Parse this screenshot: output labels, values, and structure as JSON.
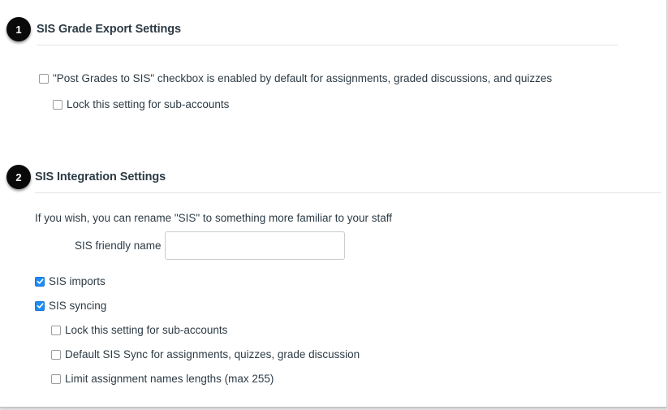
{
  "grade_export": {
    "step_number": "1",
    "title": "SIS Grade Export Settings",
    "options": [
      {
        "label": "\"Post Grades to SIS\" checkbox is enabled by default for assignments, graded discussions, and quizzes",
        "checked": false
      },
      {
        "label": "Lock this setting for sub-accounts",
        "checked": false
      }
    ]
  },
  "integration": {
    "step_number": "2",
    "title": "SIS Integration Settings",
    "rename_hint": "If you wish, you can rename \"SIS\" to something more familiar to your staff",
    "friendly_name_label": "SIS friendly name",
    "friendly_name_value": "",
    "friendly_name_placeholder": "",
    "options": [
      {
        "label": "SIS imports",
        "checked": true
      },
      {
        "label": "SIS syncing",
        "checked": true
      },
      {
        "label": "Lock this setting for sub-accounts",
        "checked": false
      },
      {
        "label": "Default SIS Sync for assignments, quizzes, grade discussion",
        "checked": false
      },
      {
        "label": "Limit assignment names lengths (max 255)",
        "checked": false
      }
    ]
  },
  "colors": {
    "checkbox_checked": "#1d8cf8",
    "step_badge": "#0a0a0a",
    "text": "#2d3b45"
  }
}
